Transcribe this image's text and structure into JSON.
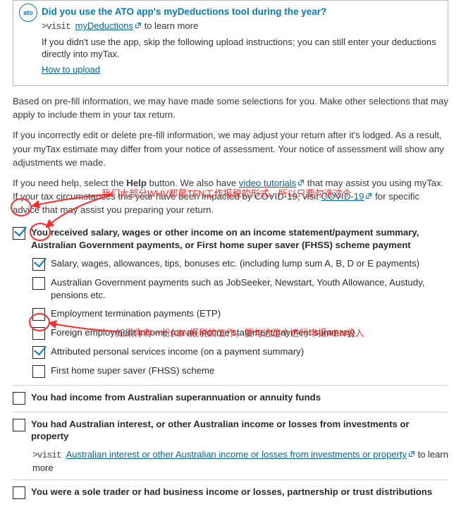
{
  "infobox": {
    "badge": "ato",
    "title": "Did you use the ATO app's myDeductions tool during the year?",
    "visit_prefix": ">visit ",
    "link1": "myDeductions",
    "learn_more": " to learn more",
    "skip_text": "If you didn't use the app, skip the following upload instructions; you can still enter your deductions directly into myTax.",
    "how_link": "How to upload"
  },
  "intro": {
    "p1": "Based on pre-fill information, we may have made some selections for you. Make other selections that may apply to include them in your tax return.",
    "p2": "If you incorrectly edit or delete pre-fill information, we may adjust your return after it's lodged. As a result, your myTax estimate may differ from your notice of assessment. Your notice of assessment will show any adjustments we made.",
    "p3a": "If you need help, select the ",
    "p3help": "Help",
    "p3b": " button. We also have ",
    "p3link1": "video tutorials",
    "p3c": " that may assist you using myTax. If your tax circumstances this year have been impacted by COVID-19, visit ",
    "p3link2": "COVID-19",
    "p3d": " for specific advice that may assist you preparing your return."
  },
  "sections": {
    "salary_header": "You received salary, wages or other income on an income statement/payment summary, Australian Government payments, or First home super saver (FHSS) scheme payment",
    "salary_items": [
      "Salary, wages, allowances, tips, bonuses etc. (including lump sum A, B, D or E payments)",
      "Australian Government payments such as JobSeeker, Newstart, Youth Allowance, Austudy, pensions etc.",
      "Employment termination payments (ETP)",
      "Foreign employment income (on an income statement/payment summary)",
      "Attributed personal services income (on a payment summary)",
      "First home super saver (FHSS) scheme"
    ],
    "super_header": "You had income from Australian superannuation or annuity funds",
    "invest_header": "You had Australian interest, or other Australian income or losses from investments or property",
    "invest_link_pre": ">visit ",
    "invest_link": "Australian interest or other Australian income or losses from investments or property",
    "invest_link_post": " to learn more",
    "soletrader_header": "You were a sole trader or had business income or losses, partnership or trust distributions"
  },
  "annot": {
    "t1": "我们大部分WHV都是TFN工作报税的形式，所以只要勾选这个",
    "t2": "如果你有一份ABN报税的工作，要勾选这个进行申报ABN收入"
  }
}
